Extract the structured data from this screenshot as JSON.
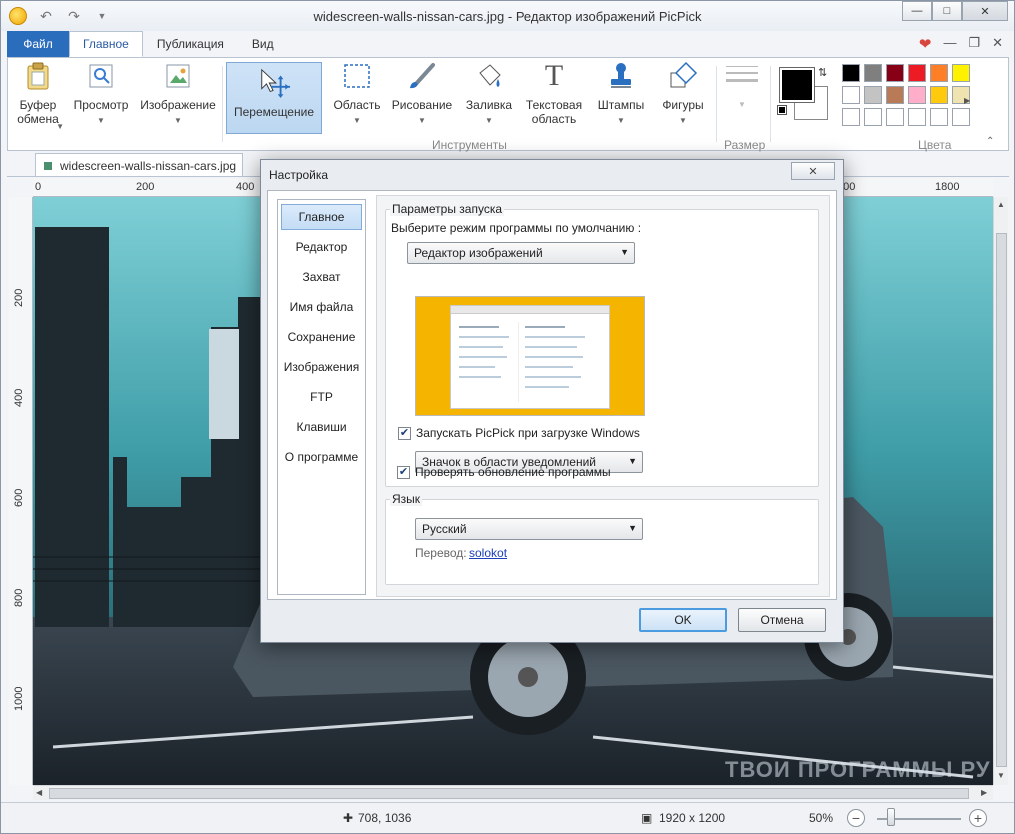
{
  "window": {
    "title": "widescreen-walls-nissan-cars.jpg - Редактор изображений PicPick",
    "min_icon": "minimize-icon",
    "max_icon": "maximize-icon",
    "close_icon": "close-icon"
  },
  "ribbon_tabs": [
    "Файл",
    "Главное",
    "Публикация",
    "Вид"
  ],
  "ribbon": {
    "clipboard": "Буфер обмена",
    "view": "Просмотр",
    "image": "Изображение",
    "move": "Перемещение",
    "area": "Область",
    "draw": "Рисование",
    "fill": "Заливка",
    "text_area": "Текстовая область",
    "stamps": "Штампы",
    "shapes": "Фигуры",
    "size": "Размер",
    "tools_group": "Инструменты",
    "colors_group": "Цвета",
    "palette": [
      "#000000",
      "#7f7f7f",
      "#880015",
      "#ed1c24",
      "#ff7f27",
      "#fff200",
      "#ffffff",
      "#c3c3c3",
      "#b97a57",
      "#ffaec9",
      "#ffc90e",
      "#efe4b0",
      "#ffffff",
      "#ffffff",
      "#ffffff",
      "#ffffff",
      "#ffffff",
      "#ffffff"
    ]
  },
  "document": {
    "tab_name": "widescreen-walls-nissan-cars.jpg",
    "hruler": [
      "0",
      "200",
      "400",
      "600",
      "1800"
    ],
    "vruler": [
      "200",
      "400",
      "600",
      "800",
      "1000"
    ]
  },
  "status": {
    "cursor": "708, 1036",
    "size": "1920 x 1200",
    "zoom": "50%",
    "zoom_level": 0.5
  },
  "watermark": "ТВОИ ПРОГРАММЫ РУ",
  "dialog": {
    "title": "Настройка",
    "nav": [
      "Главное",
      "Редактор",
      "Захват",
      "Имя файла",
      "Сохранение",
      "Изображения",
      "FTP",
      "Клавиши",
      "О программе"
    ],
    "startup_legend": "Параметры запуска",
    "default_mode_label": "Выберите режим программы по умолчанию :",
    "default_mode_value": "Редактор изображений",
    "autostart_label": "Запускать PicPick при загрузке Windows",
    "autostart_checked": true,
    "tray_value": "Значок в области уведомлений",
    "update_label": "Проверять обновление программы",
    "update_checked": true,
    "lang_legend": "Язык",
    "lang_value": "Русский",
    "translation_label": "Перевод:",
    "translation_author": "solokot",
    "ok": "OK",
    "cancel": "Отмена"
  }
}
